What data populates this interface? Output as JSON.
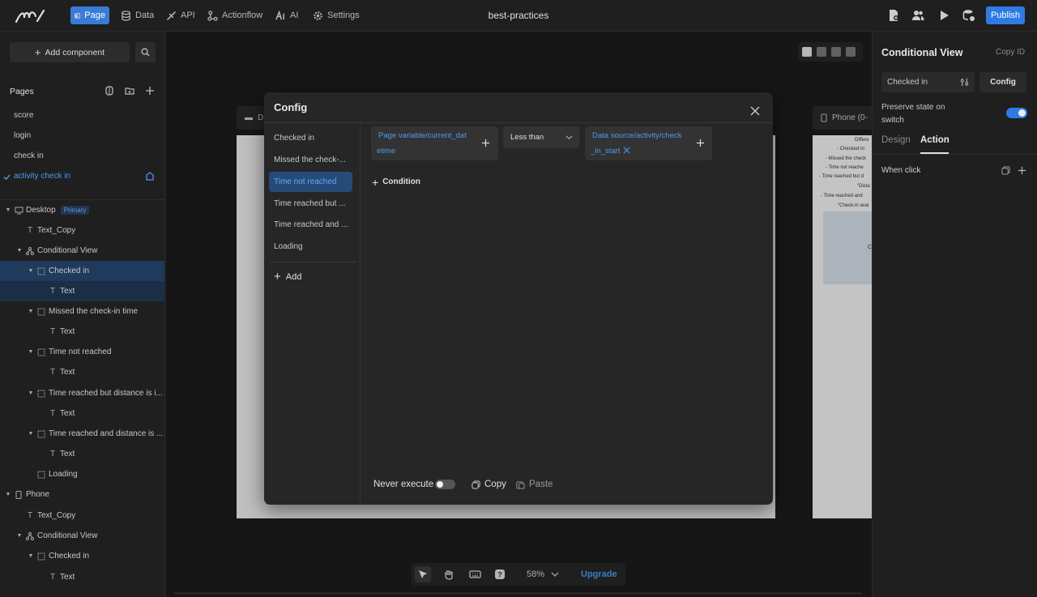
{
  "topbar": {
    "nav": [
      {
        "label": "Page",
        "icon": "page-icon"
      },
      {
        "label": "Data",
        "icon": "database-icon"
      },
      {
        "label": "API",
        "icon": "api-icon"
      },
      {
        "label": "Actionflow",
        "icon": "actionflow-icon"
      },
      {
        "label": "AI",
        "icon": "ai-icon"
      },
      {
        "label": "Settings",
        "icon": "gear-icon"
      }
    ],
    "app_title": "best-practices",
    "publish_label": "Publish",
    "accent": "#2f7be5"
  },
  "leftpanel": {
    "add_component_label": "Add component",
    "pages_label": "Pages",
    "pages": [
      "score",
      "login",
      "check in",
      "activity check in"
    ],
    "active_page": "activity check in",
    "tree": [
      {
        "label": "Desktop",
        "badge": "Primary"
      },
      {
        "label": "Text_Copy"
      },
      {
        "label": "Conditional View"
      },
      {
        "label": "Checked in"
      },
      {
        "label": "Text"
      },
      {
        "label": "Missed the check-in time"
      },
      {
        "label": "Text"
      },
      {
        "label": "Time not reached"
      },
      {
        "label": "Text"
      },
      {
        "label": "Time reached but distance is i..."
      },
      {
        "label": "Text"
      },
      {
        "label": "Time reached and distance is ..."
      },
      {
        "label": "Text"
      },
      {
        "label": "Loading"
      },
      {
        "label": "Phone"
      },
      {
        "label": "Text_Copy"
      },
      {
        "label": "Conditional View"
      },
      {
        "label": "Checked in"
      },
      {
        "label": "Text"
      }
    ]
  },
  "canvas": {
    "desktop_tab_label": "D",
    "phone_tab_label": "Phone (0-",
    "phone_lines": [
      "Differe",
      "- Checked in:",
      "- Missed the check",
      "- Time not reache",
      "- Time reached but d",
      "\"Dista",
      "- Time reached and",
      "\"Check-in avai",
      "C"
    ],
    "zoom": "58%",
    "upgrade_label": "Upgrade"
  },
  "modal": {
    "title": "Config",
    "states": [
      "Checked in",
      "Missed the check-...",
      "Time not reached",
      "Time reached but ...",
      "Time reached and ...",
      "Loading"
    ],
    "active_state": "Time not reached",
    "add_label": "Add",
    "condition": {
      "left_var_line1": "Page variable/current_dat",
      "left_var_line2": "etime",
      "operator": "Less than",
      "right_var_line1": "Data source/activity/check",
      "right_var_line2": "_in_start"
    },
    "add_condition_label": "Condition",
    "never_execute_label": "Never execute",
    "never_execute": false,
    "copy_label": "Copy",
    "paste_label": "Paste"
  },
  "rightpanel": {
    "title": "Conditional View",
    "copy_id_label": "Copy ID",
    "selected_state": "Checked in",
    "config_label": "Config",
    "preserve_label": "Preserve state on switch",
    "preserve_on": true,
    "tabs": [
      "Design",
      "Action"
    ],
    "active_tab": "Action",
    "when_click_label": "When click"
  }
}
